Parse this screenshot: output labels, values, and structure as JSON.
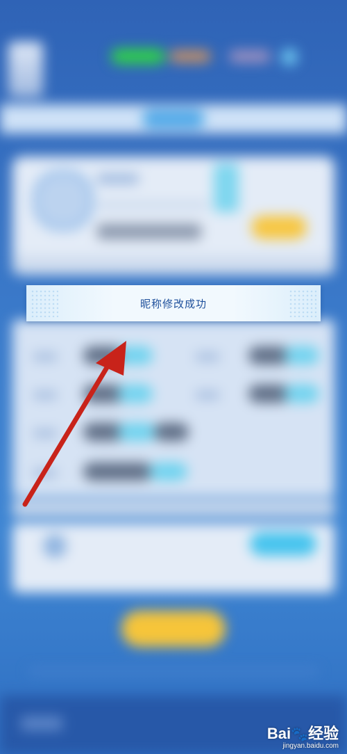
{
  "toast": {
    "message": "昵称修改成功"
  },
  "watermark": {
    "logo_prefix": "Bai",
    "logo_suffix": "经验",
    "url": "jingyan.baidu.com"
  },
  "colors": {
    "background_top": "#2f63b6",
    "background_bottom": "#2f6fc2",
    "toast_text": "#1d4f9b",
    "arrow": "#c8231a",
    "green_pill": "#2fd04a",
    "yellow_button": "#f6c53a",
    "cyan_accent": "#6fd3ef"
  },
  "icons": {
    "annotation": "red-arrow-icon",
    "watermark": "paw-icon"
  }
}
